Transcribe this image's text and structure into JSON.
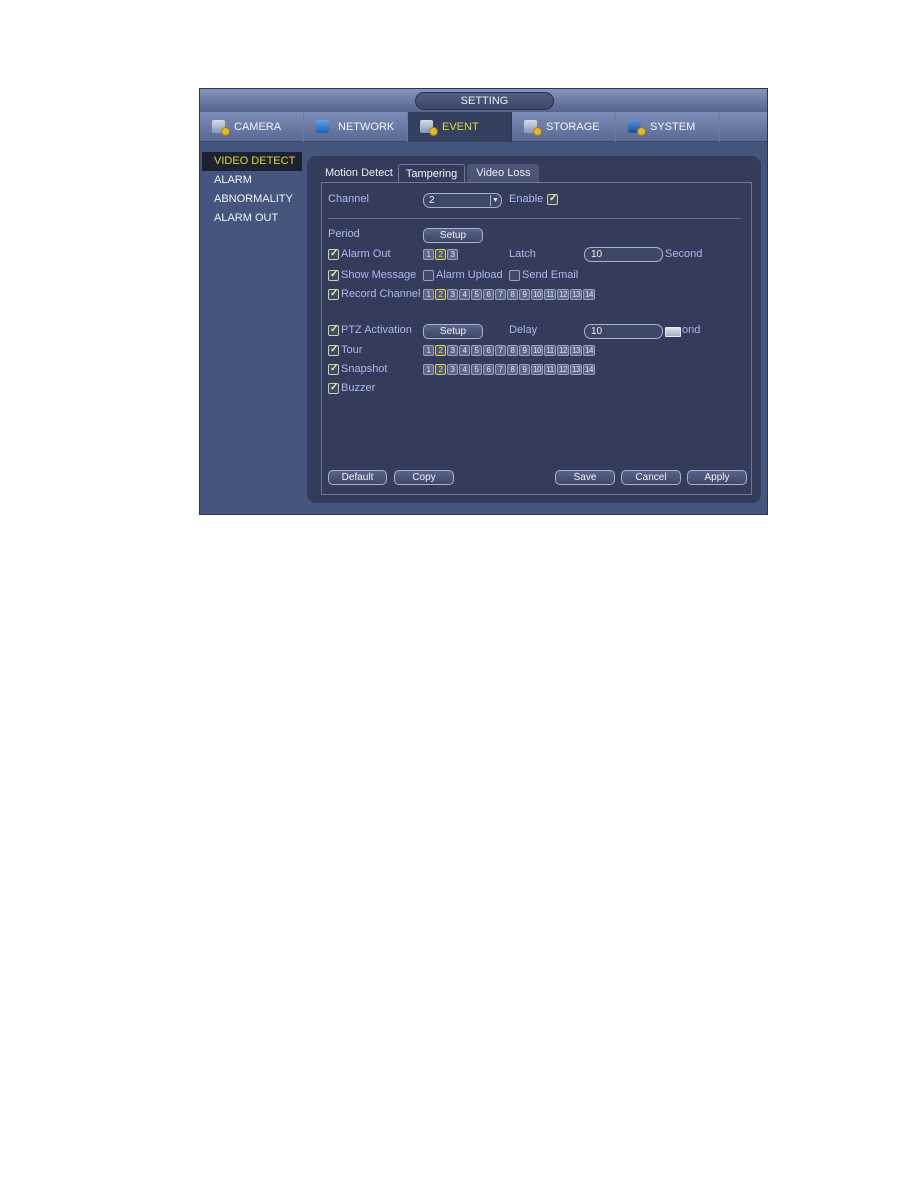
{
  "window": {
    "title": "SETTING"
  },
  "topnav": {
    "tabs": [
      {
        "label": "CAMERA",
        "icon": "camera-settings-icon",
        "active": false
      },
      {
        "label": "NETWORK",
        "icon": "network-icon",
        "active": false
      },
      {
        "label": "EVENT",
        "icon": "event-icon",
        "active": true
      },
      {
        "label": "STORAGE",
        "icon": "storage-icon",
        "active": false
      },
      {
        "label": "SYSTEM",
        "icon": "system-icon",
        "active": false
      }
    ]
  },
  "sidebar": {
    "items": [
      {
        "label": "VIDEO DETECT",
        "active": true
      },
      {
        "label": "ALARM",
        "active": false
      },
      {
        "label": "ABNORMALITY",
        "active": false
      },
      {
        "label": "ALARM OUT",
        "active": false
      }
    ]
  },
  "subtabs": [
    {
      "label": "Motion Detect",
      "active": false
    },
    {
      "label": "Tampering",
      "active": true
    },
    {
      "label": "Video Loss",
      "active": false
    }
  ],
  "form": {
    "channel": {
      "label": "Channel",
      "value": "2"
    },
    "enable": {
      "label": "Enable",
      "checked": true
    },
    "period": {
      "label": "Period",
      "button": "Setup"
    },
    "alarm_out": {
      "label": "Alarm Out",
      "checked": true,
      "outputs": [
        "1",
        "2",
        "3"
      ],
      "selected": [
        "2"
      ]
    },
    "latch": {
      "label": "Latch",
      "value": "10",
      "unit": "Second"
    },
    "show_message": {
      "label": "Show Message",
      "checked": true
    },
    "alarm_upload": {
      "label": "Alarm Upload",
      "checked": false
    },
    "send_email": {
      "label": "Send Email",
      "checked": false
    },
    "record_channel": {
      "label": "Record Channel",
      "checked": true,
      "channels": [
        "1",
        "2",
        "3",
        "4",
        "5",
        "6",
        "7",
        "8",
        "9",
        "10",
        "11",
        "12",
        "13",
        "14"
      ],
      "selected": [
        "2"
      ]
    },
    "ptz_activation": {
      "label": "PTZ Activation",
      "checked": true,
      "button": "Setup"
    },
    "delay": {
      "label": "Delay",
      "value": "10",
      "unit_visible": "ond"
    },
    "tour": {
      "label": "Tour",
      "checked": true,
      "channels": [
        "1",
        "2",
        "3",
        "4",
        "5",
        "6",
        "7",
        "8",
        "9",
        "10",
        "11",
        "12",
        "13",
        "14"
      ],
      "selected": [
        "2"
      ]
    },
    "snapshot": {
      "label": "Snapshot",
      "checked": true,
      "channels": [
        "1",
        "2",
        "3",
        "4",
        "5",
        "6",
        "7",
        "8",
        "9",
        "10",
        "11",
        "12",
        "13",
        "14"
      ],
      "selected": [
        "2"
      ]
    },
    "buzzer": {
      "label": "Buzzer",
      "checked": true
    }
  },
  "buttons": {
    "default": "Default",
    "copy": "Copy",
    "save": "Save",
    "cancel": "Cancel",
    "apply": "Apply"
  },
  "colors": {
    "accent_active": "#ebd63a",
    "label_blue": "#aeb9ef",
    "panel_bg": "#333c5b",
    "window_bg": "#46557d"
  }
}
